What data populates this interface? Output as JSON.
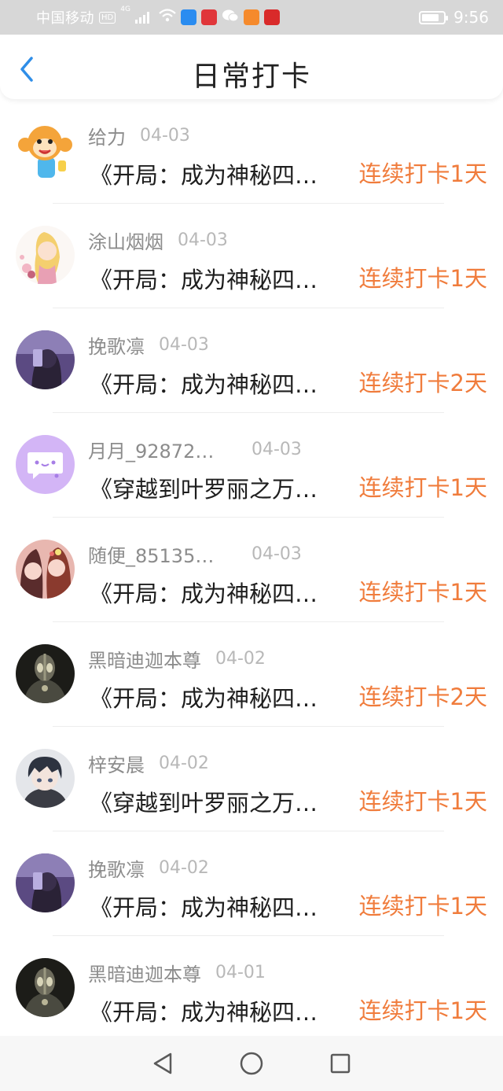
{
  "status_bar": {
    "carrier": "中国移动",
    "hd_badge": "HD",
    "network": "4G",
    "time": "9:56",
    "app_icons": [
      {
        "name": "wifi-app-icon",
        "color": "#2a8cf0"
      },
      {
        "name": "red-app-icon",
        "color": "#e0363a"
      },
      {
        "name": "wechat-icon",
        "color": "#ffffff"
      },
      {
        "name": "video-app-icon",
        "color": "#f58a2c"
      },
      {
        "name": "red-heart-app-icon",
        "color": "#d92a2a"
      }
    ]
  },
  "header": {
    "title": "日常打卡",
    "back_icon": "chevron-left-icon"
  },
  "colors": {
    "accent": "#f07c3c",
    "back_icon": "#2f8ee8",
    "username": "#8c8c8c",
    "date": "#b8b8b8"
  },
  "checkins": [
    {
      "user": "给力",
      "date": "04-03",
      "book": "《开局：成为神秘四…",
      "streak": "连续打卡1天",
      "avatar": "monkey-avatar"
    },
    {
      "user": "涂山烟烟",
      "date": "04-03",
      "book": "《开局：成为神秘四…",
      "streak": "连续打卡1天",
      "avatar": "anime-girl-avatar"
    },
    {
      "user": "挽歌凛",
      "date": "04-03",
      "book": "《开局：成为神秘四…",
      "streak": "连续打卡2天",
      "avatar": "dark-purple-avatar"
    },
    {
      "user": "月月_92872…",
      "date": "04-03",
      "book": "《穿越到叶罗丽之万…",
      "streak": "连续打卡1天",
      "avatar": "default-chat-avatar"
    },
    {
      "user": "随便_85135…",
      "date": "04-03",
      "book": "《开局：成为神秘四…",
      "streak": "连续打卡1天",
      "avatar": "anime-couple-avatar"
    },
    {
      "user": "黑暗迪迦本尊",
      "date": "04-02",
      "book": "《开局：成为神秘四…",
      "streak": "连续打卡2天",
      "avatar": "ultraman-avatar"
    },
    {
      "user": "梓安晨",
      "date": "04-02",
      "book": "《穿越到叶罗丽之万…",
      "streak": "连续打卡1天",
      "avatar": "anime-boy-avatar"
    },
    {
      "user": "挽歌凛",
      "date": "04-02",
      "book": "《开局：成为神秘四…",
      "streak": "连续打卡1天",
      "avatar": "dark-purple-avatar"
    },
    {
      "user": "黑暗迪迦本尊",
      "date": "04-01",
      "book": "《开局：成为神秘四…",
      "streak": "连续打卡1天",
      "avatar": "ultraman-avatar"
    }
  ],
  "nav_bar": {
    "back": "triangle-back-icon",
    "home": "circle-home-icon",
    "recents": "square-recents-icon"
  }
}
